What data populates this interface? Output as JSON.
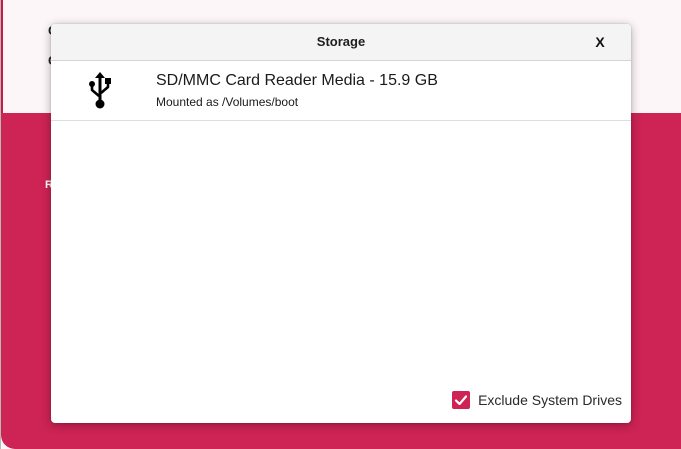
{
  "background": {
    "fragments": [
      "C",
      "C",
      "R"
    ]
  },
  "dialog": {
    "title": "Storage",
    "close_label": "X",
    "drives": [
      {
        "name": "SD/MMC Card Reader Media - 15.9 GB",
        "mount_info": "Mounted as /Volumes/boot",
        "icon": "usb-icon"
      }
    ],
    "exclude_system_drives": {
      "label": "Exclude System Drives",
      "checked": true
    }
  },
  "colors": {
    "accent": "#cd2355",
    "header_bg": "#f4f4f4"
  }
}
